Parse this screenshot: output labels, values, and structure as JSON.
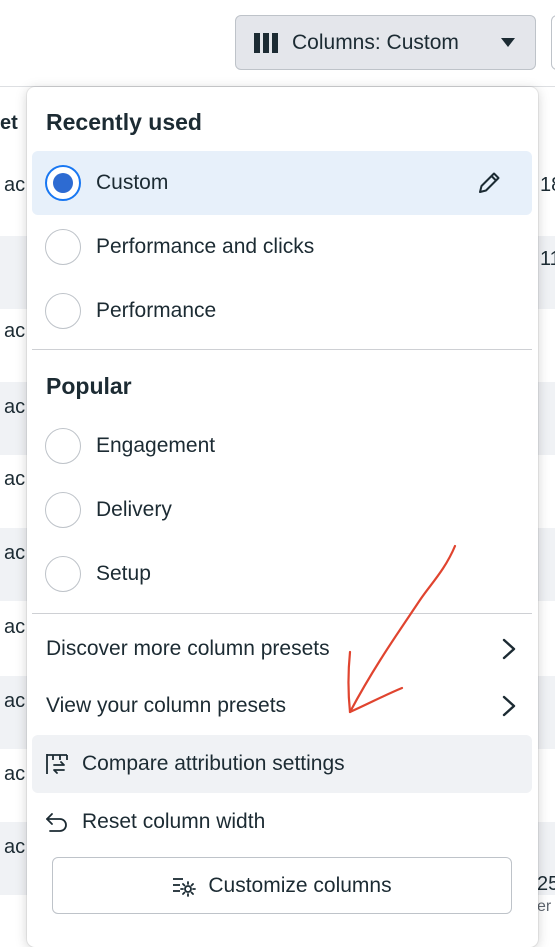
{
  "toolbar": {
    "columns_label": "Columns: Custom",
    "columns_icon": "columns-icon",
    "caret_icon": "caret-down-icon"
  },
  "background_table": {
    "header_fragment": "et",
    "row_fragments": [
      "ac",
      "ac",
      "ac",
      "ac",
      "ac",
      "ac",
      "ac",
      "ac",
      "ac"
    ],
    "right_fragments": [
      "18",
      "11",
      "25"
    ],
    "bottom_right_fragment": "er"
  },
  "menu": {
    "recently_used_title": "Recently used",
    "recently_used": [
      {
        "label": "Custom",
        "selected": true
      },
      {
        "label": "Performance and clicks",
        "selected": false
      },
      {
        "label": "Performance",
        "selected": false
      }
    ],
    "edit_icon": "pencil-icon",
    "popular_title": "Popular",
    "popular": [
      {
        "label": "Engagement",
        "selected": false
      },
      {
        "label": "Delivery",
        "selected": false
      },
      {
        "label": "Setup",
        "selected": false
      }
    ],
    "discover_label": "Discover more column presets",
    "view_presets_label": "View your column presets",
    "compare_label": "Compare attribution settings",
    "compare_icon": "compare-columns-icon",
    "reset_label": "Reset column width",
    "reset_icon": "undo-icon",
    "customize_label": "Customize columns",
    "customize_icon": "customize-settings-icon"
  },
  "colors": {
    "accent": "#1877f2",
    "radio_fill": "#2d6bd2",
    "selected_bg": "#e7f0fa",
    "annotation_red": "#e0442f"
  }
}
